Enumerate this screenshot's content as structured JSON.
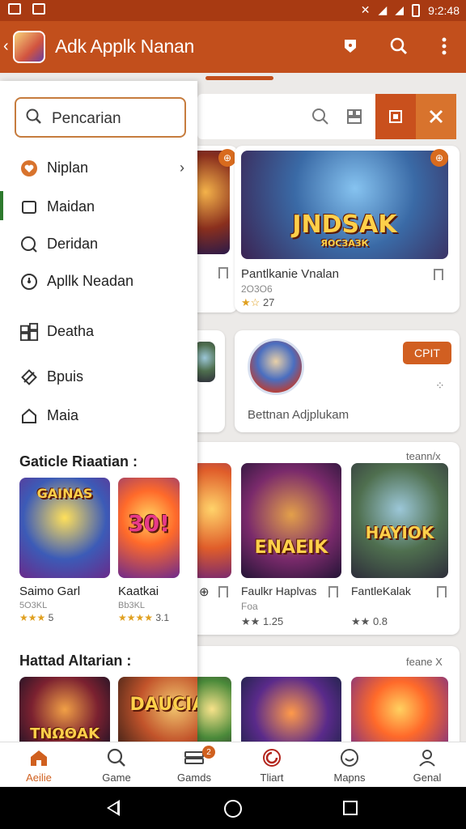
{
  "status_bar": {
    "time": "9:2:48"
  },
  "app_bar": {
    "title": "Adk Applk Nanan"
  },
  "drawer": {
    "search_placeholder": "Pencarian",
    "items": [
      {
        "label": "Niplan",
        "icon": "heart-icon"
      },
      {
        "label": "Maidan",
        "icon": "square-icon"
      },
      {
        "label": "Deridan",
        "icon": "search-circle-icon"
      },
      {
        "label": "Apllk Neadan",
        "icon": "clock-icon"
      },
      {
        "label": "Deatha",
        "icon": "grid-icon"
      },
      {
        "label": "Bpuis",
        "icon": "diamond-icon"
      },
      {
        "label": "Maia",
        "icon": "home-icon"
      }
    ],
    "section1_title": "Gaticle Riaatian :",
    "section1_games": [
      {
        "title": "Saimo Garl",
        "sub": "5O3KL",
        "stars": "★★★",
        "rating": "5"
      },
      {
        "title": "Kaatkai",
        "sub": "Bb3KL",
        "stars": "★★★★",
        "rating": "3.1"
      }
    ],
    "section2_title": "Hattad Altarian :"
  },
  "main": {
    "featured": {
      "title": "Pantlkanie Vnalan",
      "sub": "2O3O6",
      "stars": "★☆",
      "rating": "27",
      "art_text": "JNDSAK",
      "art_sub": "ЯОСЗАЗК"
    },
    "promo": {
      "title": "Bettnan Adjplukam",
      "button": "CPIT"
    },
    "section_tag1": "teann/x",
    "row_games": [
      {
        "title": "Faulkr Haplvas",
        "sub": "Foa",
        "stars": "★★",
        "rating": "1.25",
        "art_text": "ENAEIK"
      },
      {
        "title": "FantleKalak",
        "sub": "",
        "stars": "★★",
        "rating": "0.8",
        "art_text": "HAYIOK"
      }
    ],
    "section_tag2": "feane X",
    "row2_art_text": "DAUCIAK",
    "row2_left_art": "ΤΝΩΘΑΚ"
  },
  "bottom_nav": [
    {
      "label": "Aeilie",
      "icon": "home-icon"
    },
    {
      "label": "Game",
      "icon": "search-icon"
    },
    {
      "label": "Gamds",
      "icon": "controller-icon",
      "badge": "2"
    },
    {
      "label": "Tliart",
      "icon": "target-icon"
    },
    {
      "label": "Mapns",
      "icon": "smile-icon"
    },
    {
      "label": "Genal",
      "icon": "person-icon"
    }
  ]
}
